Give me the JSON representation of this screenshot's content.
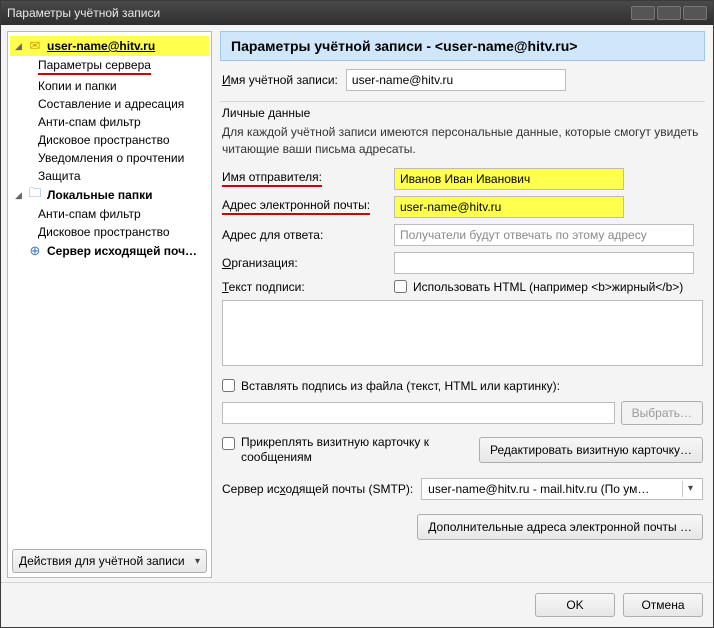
{
  "window": {
    "title": "Параметры учётной записи"
  },
  "sidebar": {
    "account_name": "user-name@hitv.ru",
    "items": [
      {
        "label": "Параметры сервера"
      },
      {
        "label": "Копии и папки"
      },
      {
        "label": "Составление и адресация"
      },
      {
        "label": "Анти-спам фильтр"
      },
      {
        "label": "Дисковое пространство"
      },
      {
        "label": "Уведомления о прочтении"
      },
      {
        "label": "Защита"
      }
    ],
    "local_folders": "Локальные папки",
    "local_items": [
      {
        "label": "Анти-спам фильтр"
      },
      {
        "label": "Дисковое пространство"
      }
    ],
    "smtp": "Сервер исходящей поч…",
    "actions_button": "Действия для учётной записи"
  },
  "main": {
    "header_prefix": "Параметры учётной записи - ",
    "header_account": "<user-name@hitv.ru>",
    "account_name_label_pre": "И",
    "account_name_label_rest": "мя учётной записи:",
    "account_name_value": "user-name@hitv.ru",
    "personal_section_title": "Личные данные",
    "personal_section_desc": "Для каждой учётной записи имеются персональные данные, которые смогут увидеть читающие ваши письма адресаты.",
    "sender_label": "Имя отправителя:",
    "sender_value": "Иванов Иван Иванович",
    "email_label": "Адрес электронной почты:",
    "email_value": "user-name@hitv.ru",
    "reply_label_rest": "Адрес для ответа:",
    "reply_placeholder": "Получатели будут отвечать по этому адресу",
    "org_label_pre": "О",
    "org_label_rest": "рганизация:",
    "sig_label_pre": "Т",
    "sig_label_rest": "екст подписи:",
    "sig_html_checkbox": "Использовать HTML (например <b>жирный</b>)",
    "attach_file_label": "Вставлять подпись из файла (текст, HTML или картинку):",
    "browse_btn": "Выбрать…",
    "vcard_checkbox": "Прикреплять визитную карточку к сообщениям",
    "vcard_edit_btn": "Редактировать визитную карточку…",
    "smtp_label_pre": "Сервер ис",
    "smtp_label_ul": "х",
    "smtp_label_rest": "одящей почты (SMTP):",
    "smtp_selected": "user-name@hitv.ru - mail.hitv.ru       (По ум…",
    "additional_btn": "Дополнительные адреса электронной почты …"
  },
  "footer": {
    "ok": "OK",
    "cancel": "Отмена"
  }
}
